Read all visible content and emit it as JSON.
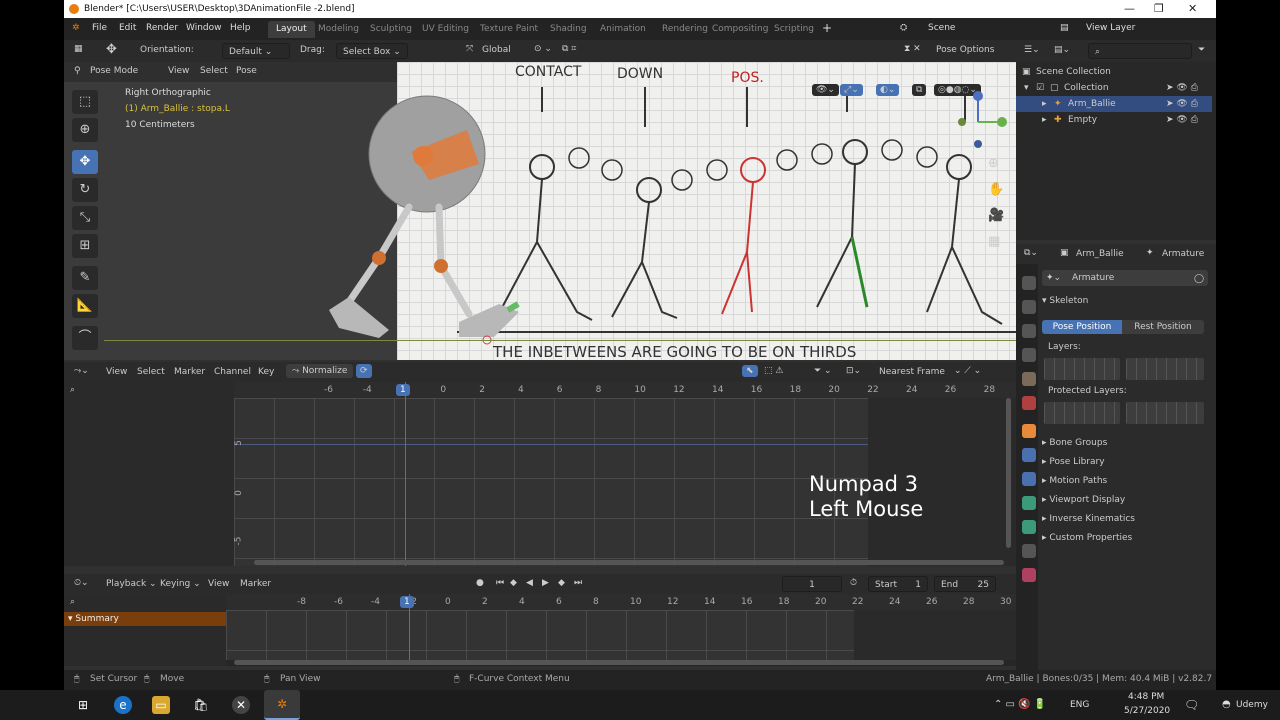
{
  "window": {
    "title": "Blender* [C:\\Users\\USER\\Desktop\\3DAnimationFile -2.blend]"
  },
  "menus": [
    "File",
    "Edit",
    "Render",
    "Window",
    "Help"
  ],
  "workspace_tabs": [
    "Layout",
    "Modeling",
    "Sculpting",
    "UV Editing",
    "Texture Paint",
    "Shading",
    "Animation",
    "Rendering",
    "Compositing",
    "Scripting"
  ],
  "active_workspace": "Layout",
  "scene": "Scene",
  "view_layer": "View Layer",
  "viewport": {
    "mode": "Pose Mode",
    "menus": [
      "View",
      "Select",
      "Pose"
    ],
    "orientation_label": "Orientation:",
    "orientation_value": "Default",
    "drag_label": "Drag:",
    "drag_value": "Select Box",
    "transform": "Global",
    "pose_options": "Pose Options",
    "info_line1": "Right Orthographic",
    "info_line2": "(1) Arm_Ballie : stopa.L",
    "info_line3": "10 Centimeters",
    "sheet_labels": [
      "CONTACT",
      "DOWN",
      "POS."
    ],
    "sheet_caption": "THE INBETWEENS ARE GOING TO BE ON THIRDS"
  },
  "outliner": {
    "title": "Scene Collection",
    "items": [
      {
        "label": "Collection",
        "indent": 1
      },
      {
        "label": "Arm_Ballie",
        "indent": 2,
        "selected": true
      },
      {
        "label": "Empty",
        "indent": 2
      }
    ]
  },
  "properties": {
    "object": "Arm_Ballie",
    "data_type": "Armature",
    "data_name": "Armature",
    "skeleton": "Skeleton",
    "pose_position": "Pose Position",
    "rest_position": "Rest Position",
    "layers": "Layers:",
    "protected_layers": "Protected Layers:",
    "panels": [
      "Bone Groups",
      "Pose Library",
      "Motion Paths",
      "Viewport Display",
      "Inverse Kinematics",
      "Custom Properties"
    ]
  },
  "graph_editor": {
    "menus": [
      "View",
      "Select",
      "Marker",
      "Channel",
      "Key"
    ],
    "normalize": "Normalize",
    "snap": "Nearest Frame",
    "ruler": [
      "-6",
      "-4",
      "-2",
      "0",
      "1",
      "2",
      "4",
      "6",
      "8",
      "10",
      "12",
      "14",
      "16",
      "18",
      "20",
      "22",
      "24",
      "26",
      "28",
      "30",
      "32"
    ],
    "y_ticks": [
      "5",
      "0",
      "-5"
    ],
    "overlay_line1": "Numpad 3",
    "overlay_line2": "Left Mouse"
  },
  "timeline": {
    "menus": [
      "Playback",
      "Keying",
      "View",
      "Marker"
    ],
    "current_frame": "1",
    "start_label": "Start",
    "start": "1",
    "end_label": "End",
    "end": "25",
    "ruler": [
      "-8",
      "-6",
      "-4",
      "-2",
      "0",
      "1",
      "2",
      "4",
      "6",
      "8",
      "10",
      "12",
      "14",
      "16",
      "18",
      "20",
      "22",
      "24",
      "26",
      "28",
      "30",
      "32"
    ],
    "summary": "Summary"
  },
  "statusbar": {
    "set_cursor": "Set Cursor",
    "move": "Move",
    "pan_view": "Pan View",
    "context_menu": "F-Curve Context Menu",
    "info": "Arm_Ballie | Bones:0/35 | Mem: 40.4 MiB | v2.82.7"
  },
  "taskbar": {
    "lang": "ENG",
    "time": "4:48 PM",
    "date": "5/27/2020",
    "udemy": "Udemy"
  },
  "colors": {
    "accent": "#4772b3",
    "blender_orange": "#e87d0d",
    "summary": "#7a3e0c"
  }
}
